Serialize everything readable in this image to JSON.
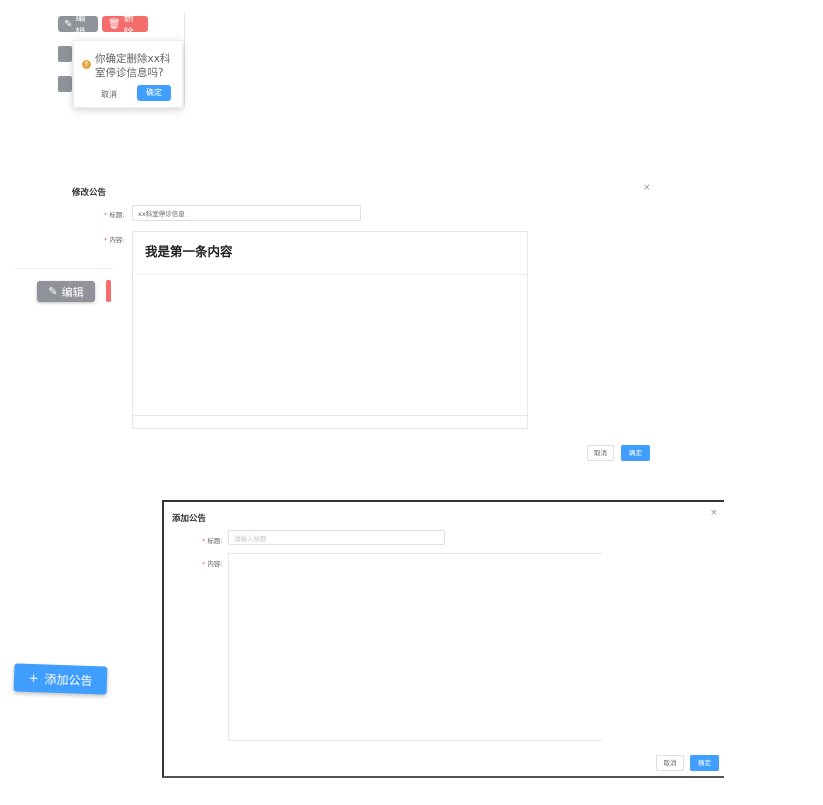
{
  "popconfirm_fragment": {
    "edit_button": "编辑",
    "delete_button": "删除",
    "message": "你确定删除xx科室停诊信息吗?",
    "cancel": "取消",
    "confirm": "确定"
  },
  "edit_dialog": {
    "title": "修改公告",
    "close": "×",
    "title_label": "标题:",
    "title_value": "xx科室停诊信息",
    "content_label": "内容:",
    "content_value": "我是第一条内容",
    "cancel": "取消",
    "confirm": "确定",
    "row_edit_button": "编辑"
  },
  "add_dialog": {
    "title": "添加公告",
    "close": "×",
    "title_label": "标题:",
    "title_placeholder": "请输入标题",
    "content_label": "内容:",
    "cancel": "取消",
    "confirm": "确定",
    "add_button": "添加公告"
  },
  "colors": {
    "primary": "#409eff",
    "danger": "#f56c6c",
    "info": "#909399",
    "warning": "#e6a23c"
  }
}
